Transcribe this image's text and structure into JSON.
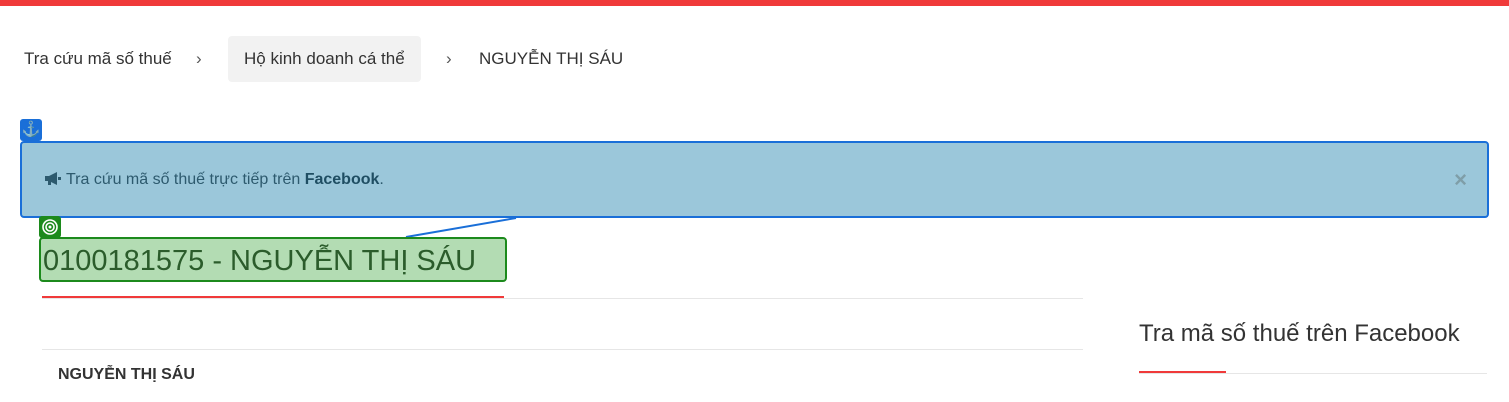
{
  "breadcrumb": {
    "items": [
      "Tra cứu mã số thuế",
      "Hộ kinh doanh cá thể",
      "NGUYỄN THỊ SÁU"
    ],
    "separator": "›"
  },
  "alert": {
    "icon": "megaphone-icon",
    "text_prefix": "Tra cứu mã số thuế trực tiếp trên ",
    "text_bold": "Facebook",
    "text_suffix": ".",
    "close": "×"
  },
  "annotations": {
    "anchor_icon": "⚓",
    "target_icon": "target-icon"
  },
  "main": {
    "title": "0100181575 - NGUYỄN THỊ SÁU",
    "name": "NGUYỄN THỊ SÁU"
  },
  "sidebar": {
    "title": "Tra mã số thuế trên Facebook"
  },
  "colors": {
    "accent_red": "#f03a3a",
    "alert_bg": "#9bc7da",
    "highlight_blue": "#1a6fd8",
    "highlight_green": "#1c8a1c",
    "title_bg": "#b3dcb3"
  }
}
